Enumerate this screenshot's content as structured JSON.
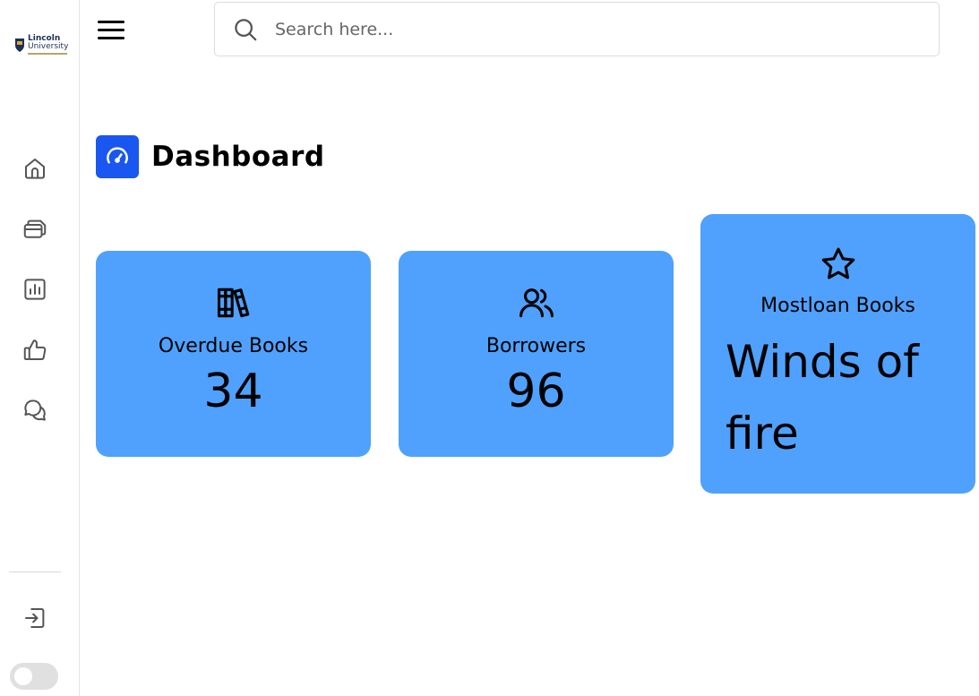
{
  "sidebar": {
    "logo": {
      "line1": "Lincoln",
      "line2": "University"
    },
    "items": [
      {
        "icon": "home-icon"
      },
      {
        "icon": "books-icon"
      },
      {
        "icon": "report-icon"
      },
      {
        "icon": "thumbs-up-icon"
      },
      {
        "icon": "chat-icon"
      }
    ],
    "logout_icon": "logout-icon",
    "theme_toggle": "off"
  },
  "header": {
    "menu_icon": "hamburger-icon",
    "search": {
      "placeholder": "Search here..."
    }
  },
  "page": {
    "title": "Dashboard",
    "title_icon": "speedometer-icon",
    "title_icon_color": "#1a56f0"
  },
  "cards": [
    {
      "icon": "books-stack-icon",
      "label": "Overdue Books",
      "value": "34"
    },
    {
      "icon": "users-icon",
      "label": "Borrowers",
      "value": "96"
    },
    {
      "icon": "star-icon",
      "label": "Mostloan Books",
      "value": "Winds of fire"
    }
  ],
  "colors": {
    "card_bg": "#4fa1fd",
    "accent": "#1a56f0"
  }
}
